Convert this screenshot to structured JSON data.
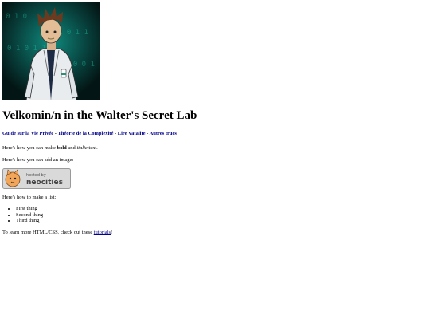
{
  "hero": {
    "binary_text": [
      "0 1 0",
      "1 0 1 1",
      "0 1 0 1 1 0",
      "1 0 0 1"
    ]
  },
  "page": {
    "title": "Velkomin/n in the Walter's Secret Lab"
  },
  "nav": {
    "links": [
      "Guide sur la Vie Privée",
      "Théorie de la Complexité",
      "Lire Vatalite",
      "Autres trucs"
    ],
    "separator": " - "
  },
  "text_demo": {
    "prefix": "Here's how you can make ",
    "bold": "bold",
    "middle": " and ",
    "italic": "italic",
    "suffix": " text."
  },
  "image_demo": {
    "text": "Here's how you can add an image:"
  },
  "badge": {
    "small": "hosted by",
    "big": "neocities"
  },
  "list_demo": {
    "intro": "Here's how to make a list:",
    "items": [
      "First thing",
      "Second thing",
      "Third thing"
    ]
  },
  "footer": {
    "prefix": "To learn more HTML/CSS, check out these ",
    "link": "tutorials",
    "suffix": "!"
  },
  "colors": {
    "link": "#00008b",
    "badge_bg": "#d9d9d9"
  }
}
